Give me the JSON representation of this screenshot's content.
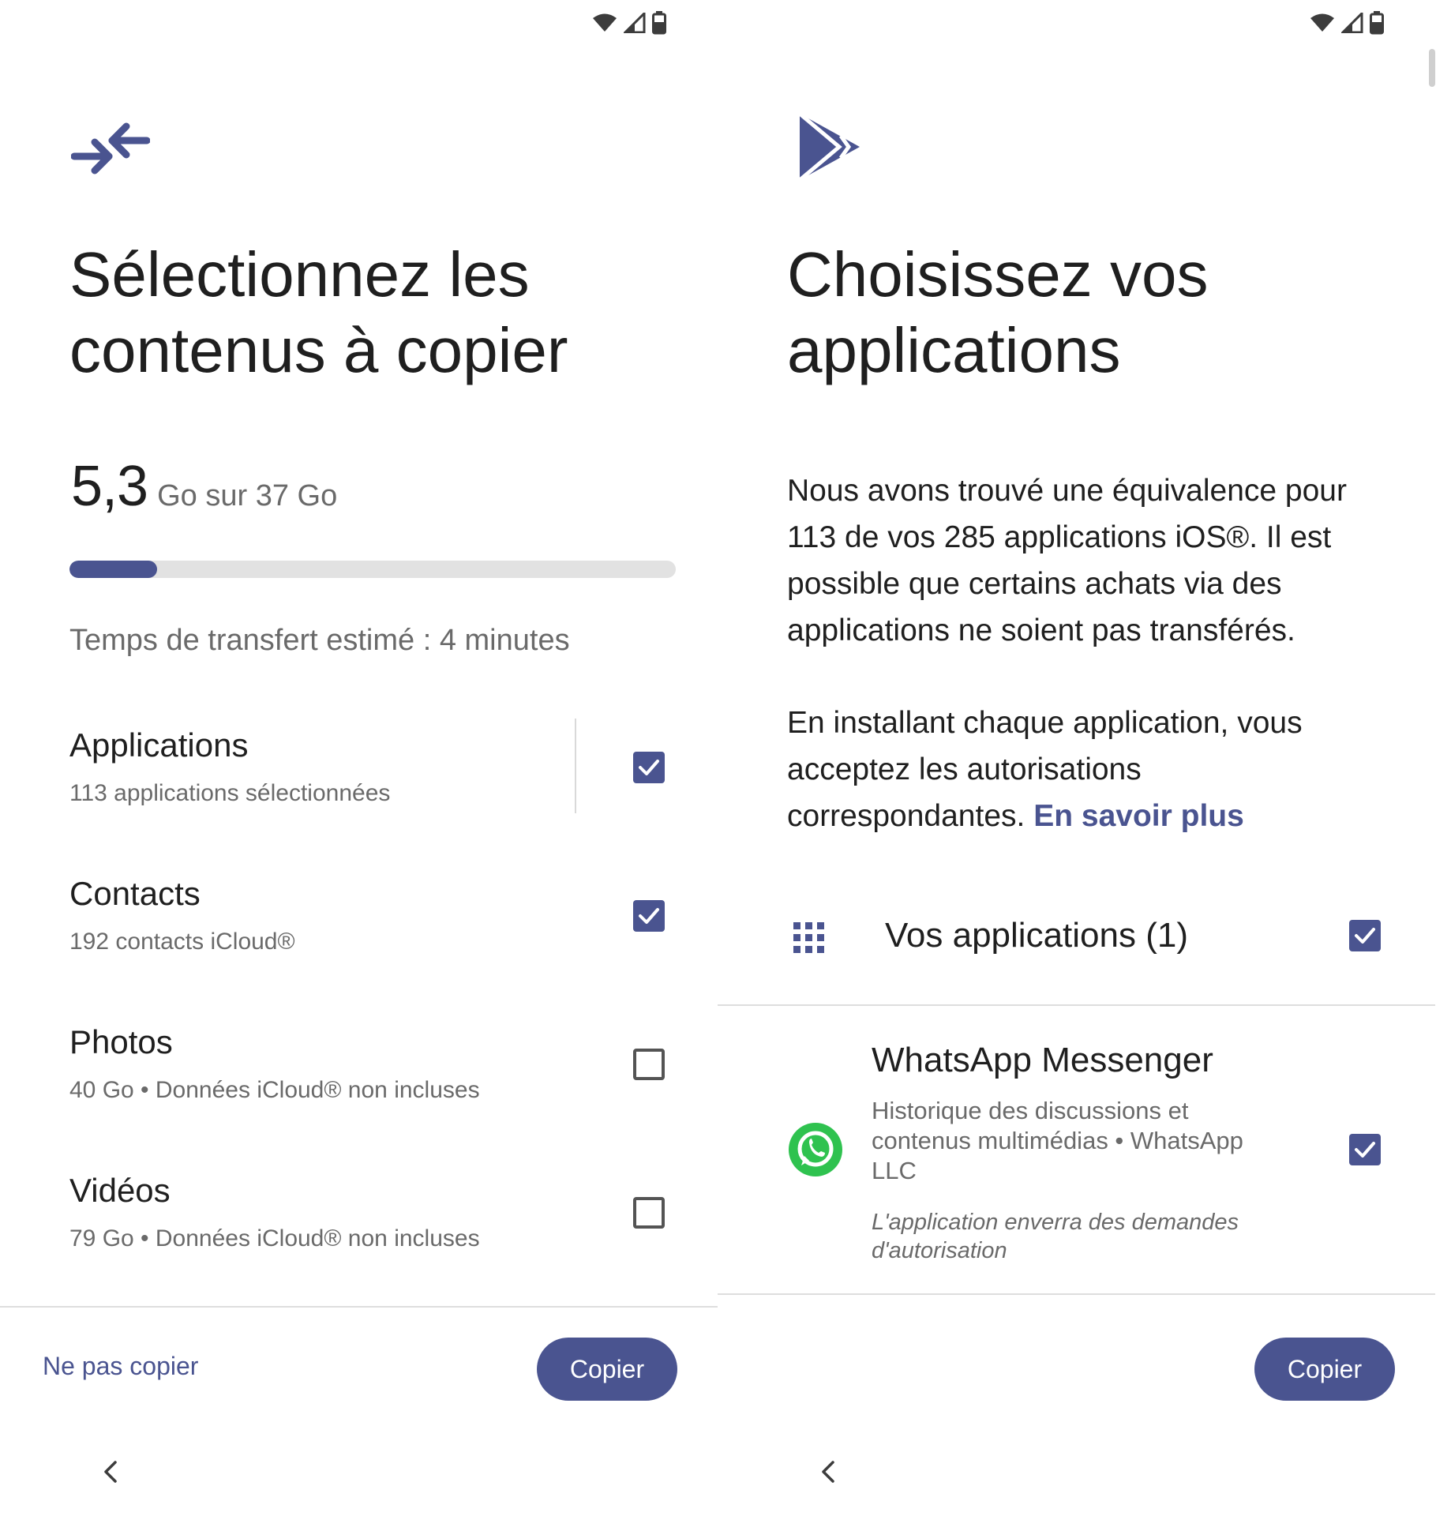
{
  "colors": {
    "accent": "#4a5490",
    "text": "#1f1f1f",
    "muted": "#6a6a6a"
  },
  "left": {
    "title": "Sélectionnez les contenus à copier",
    "storage": {
      "used": "5,3",
      "of_total": "Go sur 37 Go",
      "progress_fraction": 0.145
    },
    "eta": "Temps de transfert estimé : 4 minutes",
    "items": [
      {
        "title": "Applications",
        "subtitle": "113 applications sélectionnées",
        "checked": true
      },
      {
        "title": "Contacts",
        "subtitle": "192 contacts iCloud®",
        "checked": true
      },
      {
        "title": "Photos",
        "subtitle": "40 Go • Données iCloud® non incluses",
        "checked": false
      },
      {
        "title": "Vidéos",
        "subtitle": "79 Go • Données iCloud® non incluses",
        "checked": false
      }
    ],
    "skip_label": "Ne pas copier",
    "copy_label": "Copier"
  },
  "right": {
    "title": "Choisissez vos applications",
    "paragraph1": "Nous avons trouvé une équivalence pour 113 de vos 285 applications iOS®. Il est possible que certains achats via des applications ne soient pas transférés.",
    "paragraph2": "En installant chaque application, vous acceptez les autorisations correspondantes.",
    "learn_more": "En savoir plus",
    "apps_header": "Vos applications (1)",
    "apps_checked": true,
    "app": {
      "name": "WhatsApp Messenger",
      "subtitle": "Historique des discussions et contenus multimédias • WhatsApp LLC",
      "note": "L'application enverra des demandes d'autorisation",
      "checked": true,
      "icon": "whatsapp-icon"
    },
    "copy_label": "Copier"
  },
  "icons": {
    "hero_left": "transfer-arrows-icon",
    "hero_right": "play-store-icon",
    "grid": "apps-grid-icon",
    "back": "back-chevron-icon",
    "status": [
      "wifi-icon",
      "cellular-signal-icon",
      "battery-icon"
    ]
  }
}
